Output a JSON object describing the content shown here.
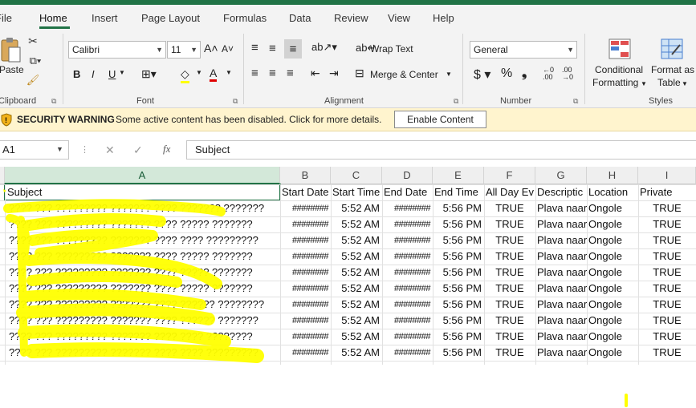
{
  "tabs": [
    "File",
    "Home",
    "Insert",
    "Page Layout",
    "Formulas",
    "Data",
    "Review",
    "View",
    "Help"
  ],
  "clipboard": {
    "paste_label": "Paste",
    "group": "Clipboard"
  },
  "font": {
    "name": "Calibri",
    "size": "11",
    "group": "Font",
    "bold": "B",
    "italic": "I",
    "underline": "U"
  },
  "alignment": {
    "wrap": "Wrap Text",
    "merge": "Merge & Center",
    "group": "Alignment"
  },
  "number": {
    "format": "General",
    "group": "Number"
  },
  "styles": {
    "conditional_1": "Conditional",
    "conditional_2": "Formatting",
    "format_1": "Format as",
    "format_2": "Table",
    "group": "Styles"
  },
  "security": {
    "title": "SECURITY WARNING",
    "message": "Some active content has been disabled. Click for more details.",
    "button": "Enable Content"
  },
  "formula": {
    "namebox": "A1",
    "fx": "fx",
    "value": "Subject"
  },
  "columns": [
    "A",
    "B",
    "C",
    "D",
    "E",
    "F",
    "G",
    "H",
    "I"
  ],
  "headers": [
    "Subject",
    "Start Date",
    "Start Time",
    "End Date",
    "End Time",
    "All Day Ev",
    "Descriptic",
    "Location",
    "Private"
  ],
  "rows": [
    [
      "???? ??? ????????? ??????? ???? ??????? ???????",
      "########",
      "5:52 AM",
      "########",
      "5:56 PM",
      "TRUE",
      "Plava naar",
      "Ongole",
      "TRUE"
    ],
    [
      "???? ??? ????????? ??????? ???? ????? ???????",
      "########",
      "5:52 AM",
      "########",
      "5:56 PM",
      "TRUE",
      "Plava naar",
      "Ongole",
      "TRUE"
    ],
    [
      "???? ??? ????????? ??????? ???? ???? ?????????",
      "########",
      "5:52 AM",
      "########",
      "5:56 PM",
      "TRUE",
      "Plava naar",
      "Ongole",
      "TRUE"
    ],
    [
      "???? ??? ????????? ??????? ???? ????? ???????",
      "########",
      "5:52 AM",
      "########",
      "5:56 PM",
      "TRUE",
      "Plava naar",
      "Ongole",
      "TRUE"
    ],
    [
      "???? ??? ????????? ??????? ???? ????? ???????",
      "########",
      "5:52 AM",
      "########",
      "5:56 PM",
      "TRUE",
      "Plava naar",
      "Ongole",
      "TRUE"
    ],
    [
      "???? ??? ????????? ??????? ????  ????? ???????",
      "########",
      "5:52 AM",
      "########",
      "5:56 PM",
      "TRUE",
      "Plava naar",
      "Ongole",
      "TRUE"
    ],
    [
      "???? ??? ????????? ???????  ????  ?????? ????????",
      "########",
      "5:52 AM",
      "########",
      "5:56 PM",
      "TRUE",
      "Plava naar",
      "Ongole",
      "TRUE"
    ],
    [
      "???? ??? ????????? ??????? ???? ?????? ???????",
      "########",
      "5:52 AM",
      "########",
      "5:56 PM",
      "TRUE",
      "Plava naar",
      "Ongole",
      "TRUE"
    ],
    [
      "???? ??? ????????? ??????? ????  ???? ????????",
      "########",
      "5:52 AM",
      "########",
      "5:56 PM",
      "TRUE",
      "Plava naar",
      "Ongole",
      "TRUE"
    ],
    [
      "???? ??? ????????? ??????? ????  ???? ?????????",
      "########",
      "5:52 AM",
      "########",
      "5:56 PM",
      "TRUE",
      "Plava naar",
      "Ongole",
      "TRUE"
    ]
  ],
  "colors": {
    "accent": "#217346",
    "highlight": "#ffff00",
    "warning_bg": "#fff4ce"
  }
}
